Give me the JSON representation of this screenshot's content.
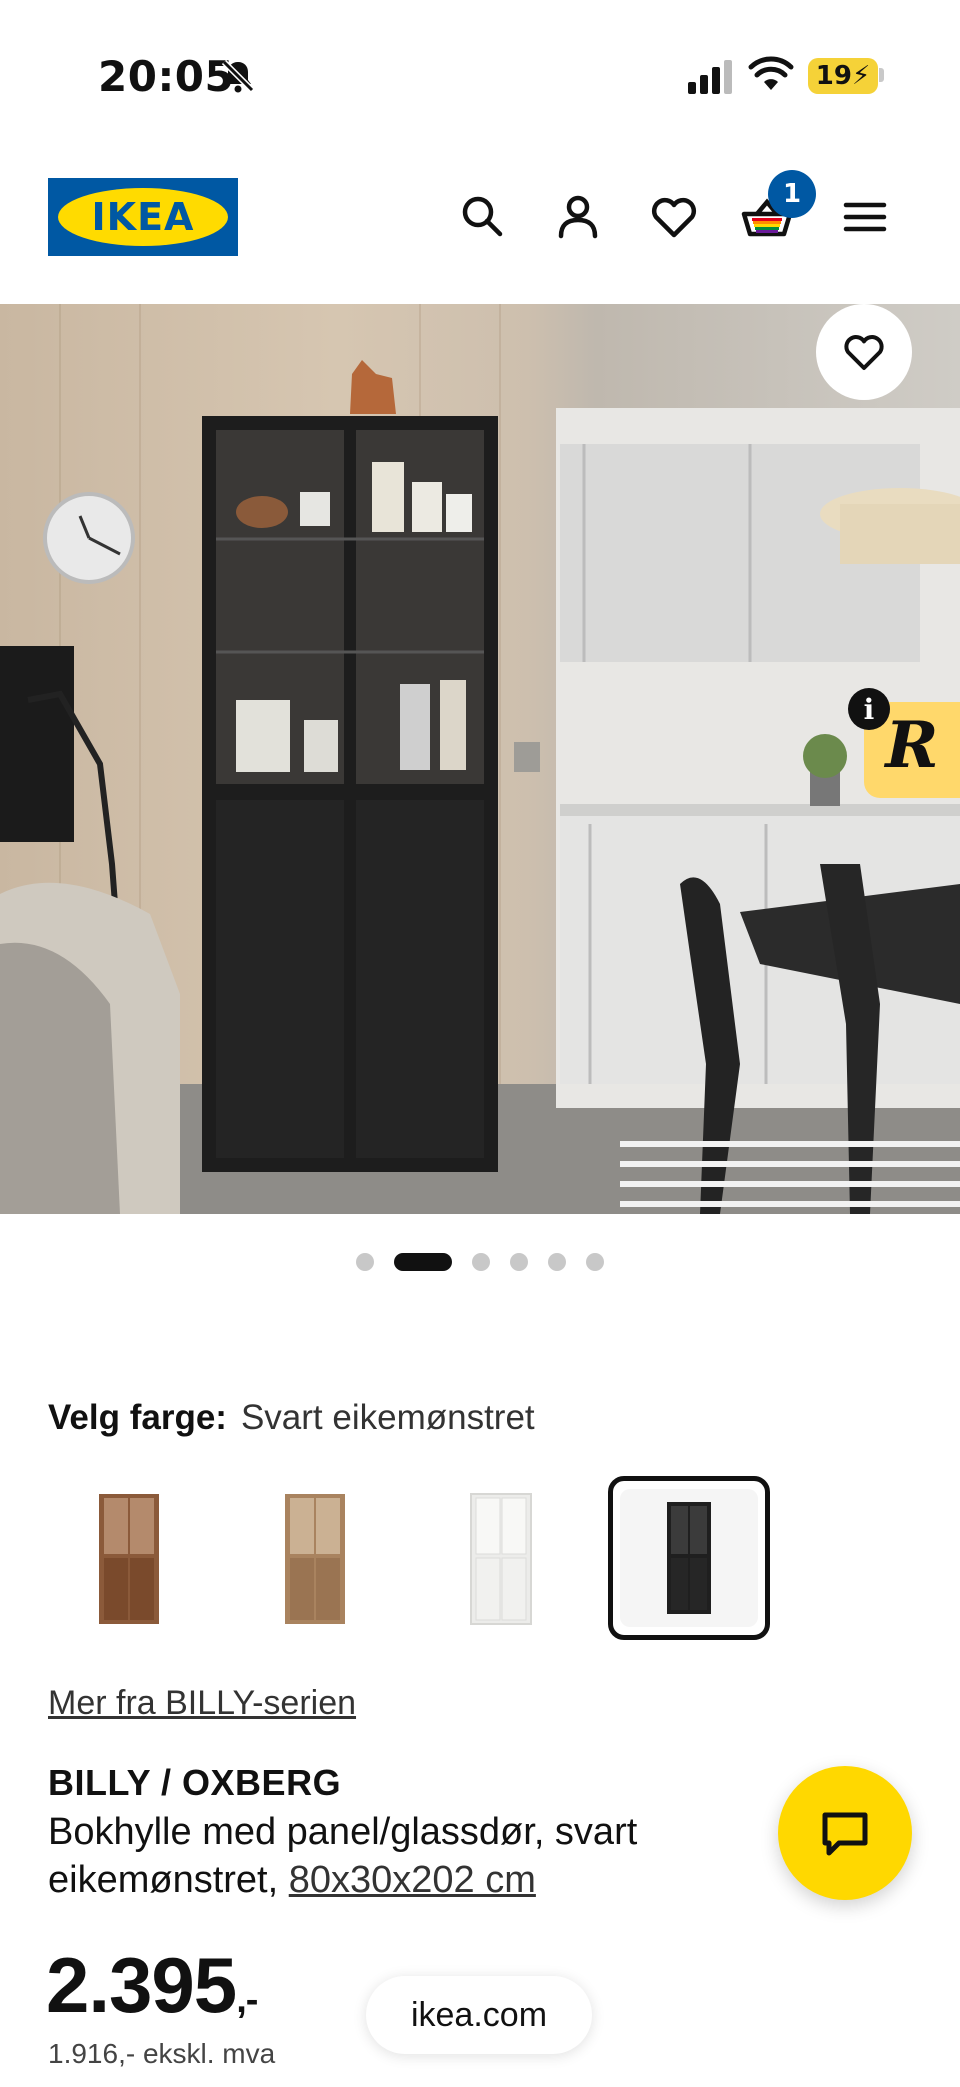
{
  "status_bar": {
    "time": "20:05",
    "battery": "19",
    "icons": [
      "bell-slash-icon",
      "signal-icon",
      "wifi-icon",
      "battery-charging-icon"
    ]
  },
  "header": {
    "logo_text": "IKEA",
    "icons": [
      "search-icon",
      "account-icon",
      "heart-icon",
      "cart-icon",
      "menu-icon"
    ],
    "cart_count": "1",
    "colors": {
      "brand_blue": "#0058a3",
      "brand_yellow": "#ffdb00"
    }
  },
  "hero": {
    "carousel_count": 6,
    "carousel_active_index": 1,
    "favourite_icon": "heart-outline-icon",
    "assistant_badge": "R",
    "info_badge": "i"
  },
  "colour": {
    "label": "Velg farge:",
    "value": "Svart eikemønstret",
    "swatches": [
      {
        "name": "brown-walnut",
        "color": "#8b5a3a"
      },
      {
        "name": "oak",
        "color": "#a9835f"
      },
      {
        "name": "white",
        "color": "#f2f2ef"
      },
      {
        "name": "black-oak",
        "color": "#1f1f1f"
      }
    ],
    "selected_index": 3
  },
  "series_link": "Mer fra BILLY-serien",
  "product": {
    "name": "BILLY / OXBERG",
    "description": "Bokhylle med panel/glassdør, svart eikemønstret,",
    "dimensions": "80x30x202 cm"
  },
  "price": {
    "main": "2.395",
    "suffix": ",-",
    "ex_vat": "1.916,- ekskl. mva"
  },
  "chat_icon": "chat-bubble-icon",
  "url_bar": "ikea.com"
}
